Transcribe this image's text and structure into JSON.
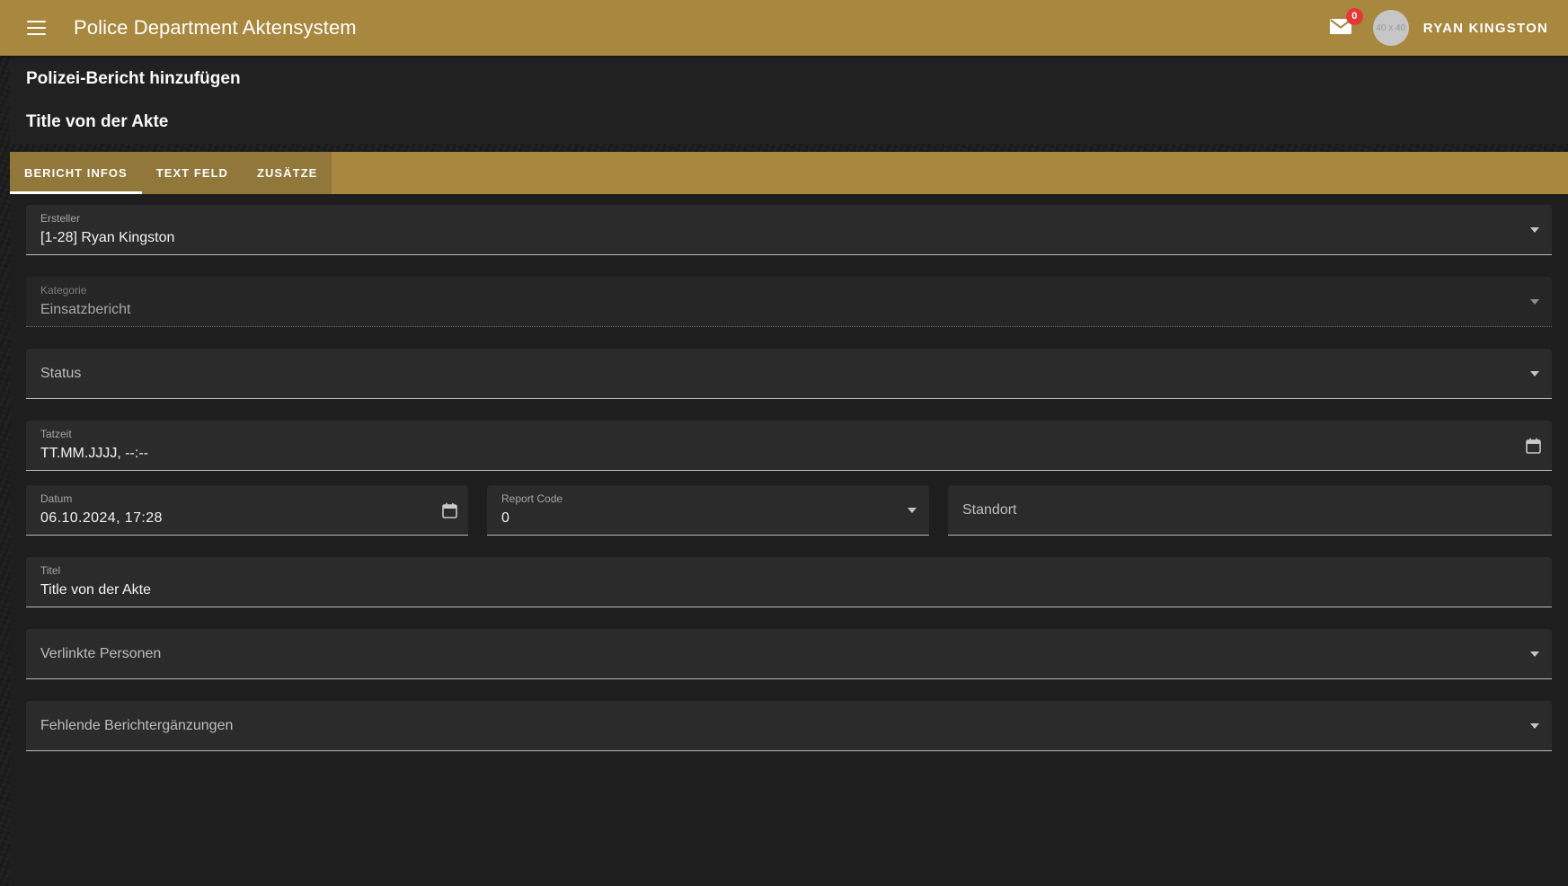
{
  "appbar": {
    "menu_icon": "hamburger-menu-icon",
    "title": "Police Department Aktensystem",
    "mail_icon": "mail-envelope-icon",
    "mail_badge_count": "0",
    "avatar_placeholder": "40 x 40",
    "username": "RYAN KINGSTON",
    "background_color": "#a8873f"
  },
  "page": {
    "heading": "Polizei-Bericht hinzufügen",
    "subheading": "Title von der Akte"
  },
  "tabs": {
    "items": [
      {
        "label": "BERICHT INFOS",
        "active": true
      },
      {
        "label": "TEXT FELD",
        "active": false
      },
      {
        "label": "ZUSÄTZE",
        "active": false
      }
    ],
    "group_background": "#917739",
    "bar_background": "#a8873f",
    "active_indicator_color": "#ffffff"
  },
  "form": {
    "ersteller": {
      "label": "Ersteller",
      "value": "[1-28] Ryan Kingston",
      "type": "select",
      "dropdown_icon": "chevron-down-icon"
    },
    "kategorie": {
      "label": "Kategorie",
      "value": "Einsatzbericht",
      "type": "select",
      "disabled": true,
      "dropdown_icon": "chevron-down-icon"
    },
    "status": {
      "label": "Status",
      "value": "",
      "type": "select",
      "dropdown_icon": "chevron-down-icon"
    },
    "tatzeit": {
      "label": "Tatzeit",
      "placeholder": "TT.MM.JJJJ, --:--",
      "value": "",
      "type": "datetime-local",
      "calendar_icon": "calendar-icon"
    },
    "datum": {
      "label": "Datum",
      "value": "06.10.2024, 17:28",
      "type": "datetime-local",
      "calendar_icon": "calendar-icon"
    },
    "report_code": {
      "label": "Report Code",
      "value": "0",
      "type": "select",
      "dropdown_icon": "chevron-down-icon"
    },
    "standort": {
      "label": "Standort",
      "value": "",
      "type": "text"
    },
    "titel": {
      "label": "Titel",
      "value": "Title von der Akte",
      "type": "text"
    },
    "verlinkte_personen": {
      "label": "Verlinkte Personen",
      "value": "",
      "type": "select",
      "dropdown_icon": "chevron-down-icon"
    },
    "fehlende_berichtergaenzungen": {
      "label": "Fehlende Berichtergänzungen",
      "value": "",
      "type": "select",
      "dropdown_icon": "chevron-down-icon"
    }
  }
}
